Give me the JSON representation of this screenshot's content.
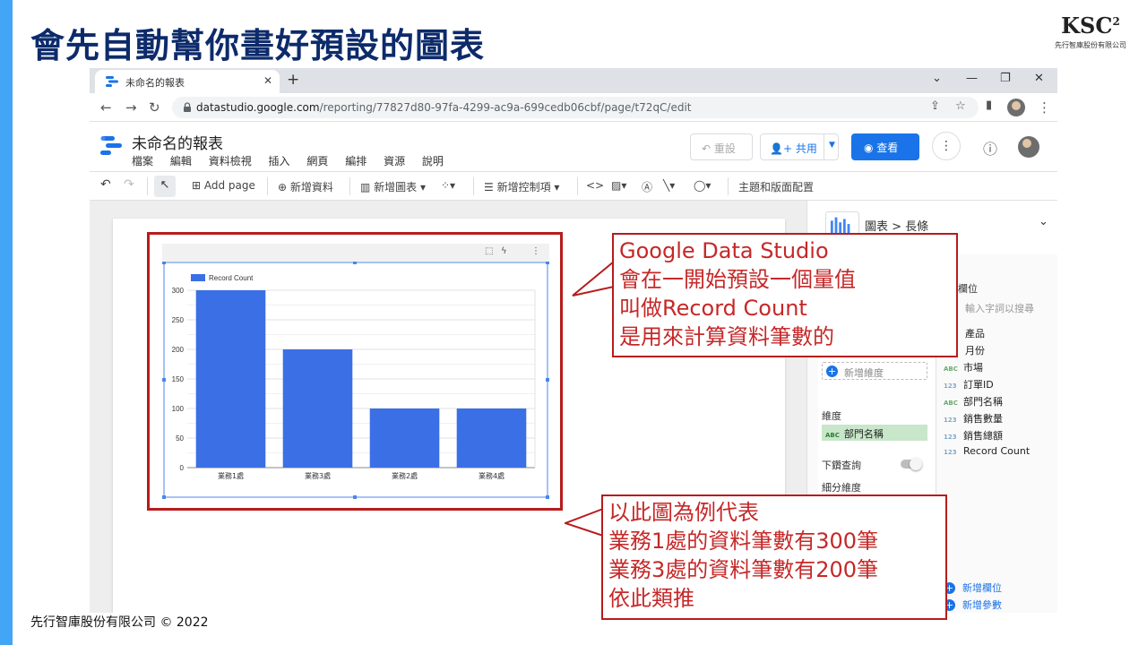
{
  "slide": {
    "title": "會先自動幫你畫好預設的圖表",
    "logo_text": "KSC",
    "logo_sup": "2",
    "logo_subtitle": "先行智庫股份有限公司",
    "footer": "先行智庫股份有限公司 © 2022"
  },
  "browser": {
    "tab_title": "未命名的報表",
    "url_host": "datastudio.google.com",
    "url_path": "/reporting/77827d80-97fa-4299-ac9a-699cedb06cbf/page/t72qC/edit"
  },
  "app": {
    "report_title": "未命名的報表",
    "menu": [
      "檔案",
      "編輯",
      "資料檢視",
      "插入",
      "網頁",
      "編排",
      "資源",
      "說明"
    ],
    "reset_label": "重設",
    "share_label": "共用",
    "view_label": "查看"
  },
  "toolbar": {
    "add_page": "Add page",
    "add_data": "新增資料",
    "add_chart": "新增圖表",
    "add_control": "新增控制項",
    "theme": "主題和版面配置"
  },
  "panel": {
    "crumb": "圖表 > 長條",
    "add_dimension": "新增維度",
    "dimension_label": "維度",
    "dimension_value": "部門名稱",
    "dimension_type": "ABC",
    "drill_label": "下鑽查詢",
    "breakdown_label": "細分維度",
    "fields_title": "欄位",
    "fields_search": "輸入字詞以搜尋",
    "fields": [
      {
        "type": "",
        "name": "產品"
      },
      {
        "type": "",
        "name": "月份"
      },
      {
        "type": "ABC",
        "name": "市場"
      },
      {
        "type": "123",
        "name": "訂單ID"
      },
      {
        "type": "ABC",
        "name": "部門名稱"
      },
      {
        "type": "123",
        "name": "銷售數量"
      },
      {
        "type": "123",
        "name": "銷售總額"
      },
      {
        "type": "123",
        "name": "Record Count"
      }
    ],
    "add_field": "新增欄位",
    "add_param": "新增參數"
  },
  "chart_data": {
    "type": "bar",
    "legend": [
      "Record Count"
    ],
    "categories": [
      "業務1處",
      "業務3處",
      "業務2處",
      "業務4處"
    ],
    "series": [
      {
        "name": "Record Count",
        "values": [
          300,
          200,
          100,
          100
        ]
      }
    ],
    "yticks": [
      0,
      50,
      100,
      150,
      200,
      250,
      300
    ],
    "ylim": [
      0,
      300
    ],
    "color": "#3b6fe6",
    "grid": true,
    "legend_position": "top-left"
  },
  "callouts": {
    "first": [
      "Google Data Studio",
      "會在一開始預設一個量值",
      "叫做Record Count",
      "是用來計算資料筆數的"
    ],
    "second": [
      "以此圖為例代表",
      "業務1處的資料筆數有300筆",
      "業務3處的資料筆數有200筆",
      "依此類推"
    ]
  },
  "colors": {
    "title": "#0d2b6b",
    "accent_bar": "#42a5f5",
    "callout": "#b71c1c",
    "primary": "#1a73e8"
  }
}
